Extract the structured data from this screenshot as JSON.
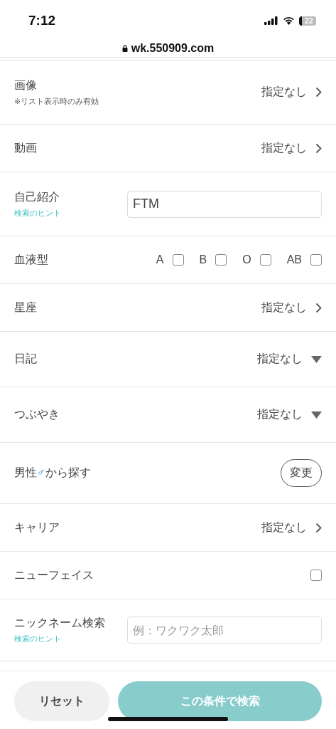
{
  "status_bar": {
    "time": "7:12",
    "battery": "22"
  },
  "address_bar": {
    "url": "wk.550909.com"
  },
  "rows": [
    {
      "kind": "select",
      "label": "画像",
      "note": "※リスト表示時のみ有効",
      "value": "指定なし"
    },
    {
      "kind": "select",
      "label": "動画",
      "value": "指定なし"
    },
    {
      "kind": "input",
      "label": "自己紹介",
      "hint_link": "検索のヒント",
      "value": "FTM"
    },
    {
      "kind": "checks",
      "label": "血液型",
      "options": [
        {
          "label": "A",
          "checked": false
        },
        {
          "label": "B",
          "checked": false
        },
        {
          "label": "O",
          "checked": false
        },
        {
          "label": "AB",
          "checked": false
        }
      ]
    },
    {
      "kind": "select",
      "label": "星座",
      "value": "指定なし"
    },
    {
      "kind": "dropdown",
      "label": "日記",
      "value": "指定なし"
    },
    {
      "kind": "dropdown",
      "label": "つぶやき",
      "value": "指定なし"
    },
    {
      "kind": "button",
      "label": "男性",
      "symbol": "♂",
      "label_after": "から探す",
      "button": "変更"
    },
    {
      "kind": "select",
      "label": "キャリア",
      "value": "指定なし"
    },
    {
      "kind": "checkbox",
      "label": "ニューフェイス",
      "checked": false
    },
    {
      "kind": "input",
      "label": "ニックネーム検索",
      "hint_link": "検索のヒント",
      "placeholder": "例：ワクワク太郎"
    }
  ],
  "footer": {
    "reset": "リセット",
    "search": "この条件で検索"
  }
}
